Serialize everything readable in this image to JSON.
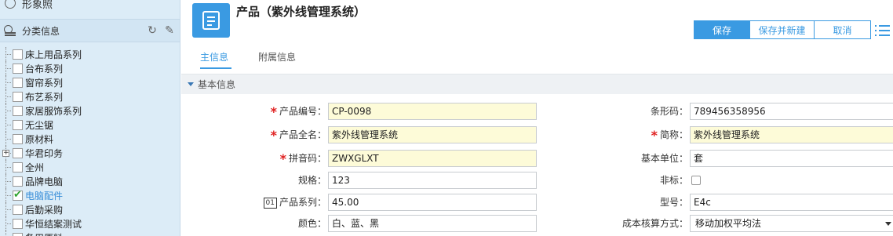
{
  "sidebar": {
    "top_item": "形象照",
    "category_title": "分类信息",
    "tree": [
      {
        "label": "床上用品系列",
        "checked": false,
        "expandable": false
      },
      {
        "label": "台布系列",
        "checked": false,
        "expandable": false
      },
      {
        "label": "窗帘系列",
        "checked": false,
        "expandable": false
      },
      {
        "label": "布艺系列",
        "checked": false,
        "expandable": false
      },
      {
        "label": "家居服饰系列",
        "checked": false,
        "expandable": false
      },
      {
        "label": "无尘锯",
        "checked": false,
        "expandable": false
      },
      {
        "label": "原材料",
        "checked": false,
        "expandable": false
      },
      {
        "label": "华君印务",
        "checked": false,
        "expandable": true
      },
      {
        "label": "全州",
        "checked": false,
        "expandable": false
      },
      {
        "label": "品牌电脑",
        "checked": false,
        "expandable": false
      },
      {
        "label": "电脑配件",
        "checked": true,
        "expandable": false
      },
      {
        "label": "后勤采购",
        "checked": false,
        "expandable": false
      },
      {
        "label": "华恒结案测试",
        "checked": false,
        "expandable": false
      },
      {
        "label": "备用原料",
        "checked": false,
        "expandable": false
      }
    ]
  },
  "header": {
    "title": "产品（紫外线管理系统）",
    "buttons": {
      "save": "保存",
      "save_new": "保存并新建",
      "cancel": "取消"
    }
  },
  "tabs": [
    "主信息",
    "附属信息"
  ],
  "section": {
    "title": "基本信息"
  },
  "form": {
    "product_code": {
      "label": "产品编号：",
      "value": "CP-0098"
    },
    "barcode": {
      "label": "条形码：",
      "value": "789456358956"
    },
    "full_name": {
      "label": "产品全名：",
      "value": "紫外线管理系统"
    },
    "short_name": {
      "label": "简称：",
      "value": "紫外线管理系统"
    },
    "pinyin": {
      "label": "拼音码：",
      "value": "ZWXGLXT"
    },
    "base_unit": {
      "label": "基本单位：",
      "value": "套"
    },
    "spec": {
      "label": "规格：",
      "value": "123"
    },
    "non_standard": {
      "label": "非标：",
      "checked": false
    },
    "series": {
      "label": "产品系列：",
      "icon_text": "01",
      "value": "45.00"
    },
    "model": {
      "label": "型号：",
      "value": "E4c"
    },
    "color": {
      "label": "颜色：",
      "value": "白、蓝、黑"
    },
    "cost_method": {
      "label": "成本核算方式：",
      "value": "移动加权平均法"
    }
  }
}
